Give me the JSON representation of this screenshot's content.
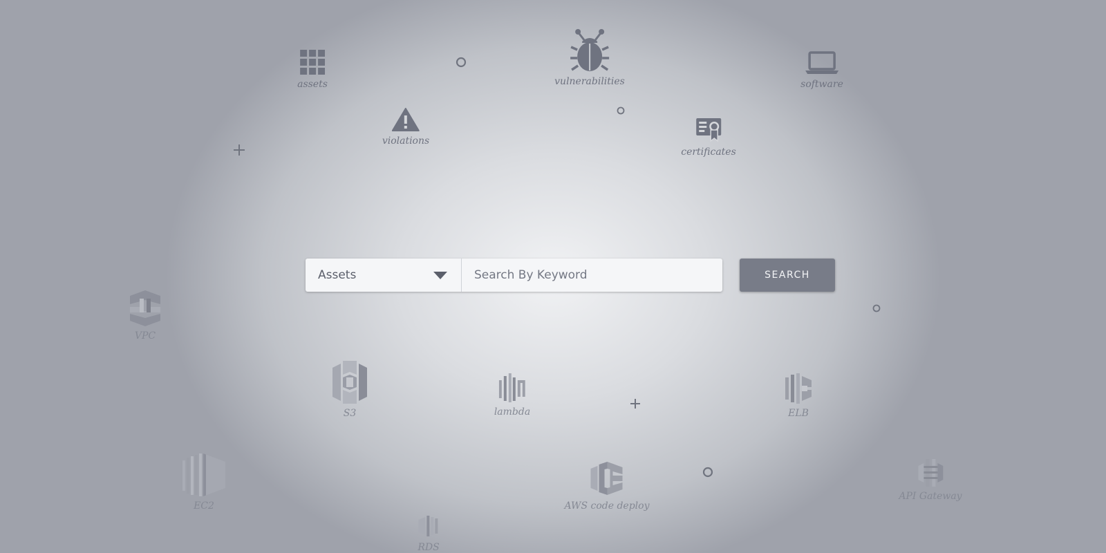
{
  "search": {
    "category": "Assets",
    "placeholder": "Search By Keyword",
    "button_label": "SEARCH"
  },
  "categories": {
    "assets": "assets",
    "vulnerabilities": "vulnerabilities",
    "software": "software",
    "violations": "violations",
    "certificates": "certificates"
  },
  "aws_services": {
    "vpc": "VPC",
    "s3": "S3",
    "lambda": "lambda",
    "elb": "ELB",
    "ec2": "EC2",
    "code_deploy": "AWS code deploy",
    "api_gateway": "API Gateway",
    "rds": "RDS"
  },
  "icons": {
    "assets": "grid-icon",
    "vulnerabilities": "bug-icon",
    "software": "laptop-icon",
    "violations": "warning-icon",
    "certificates": "certificate-icon"
  },
  "colors": {
    "icon": "#6f7380",
    "button": "#787c88"
  }
}
